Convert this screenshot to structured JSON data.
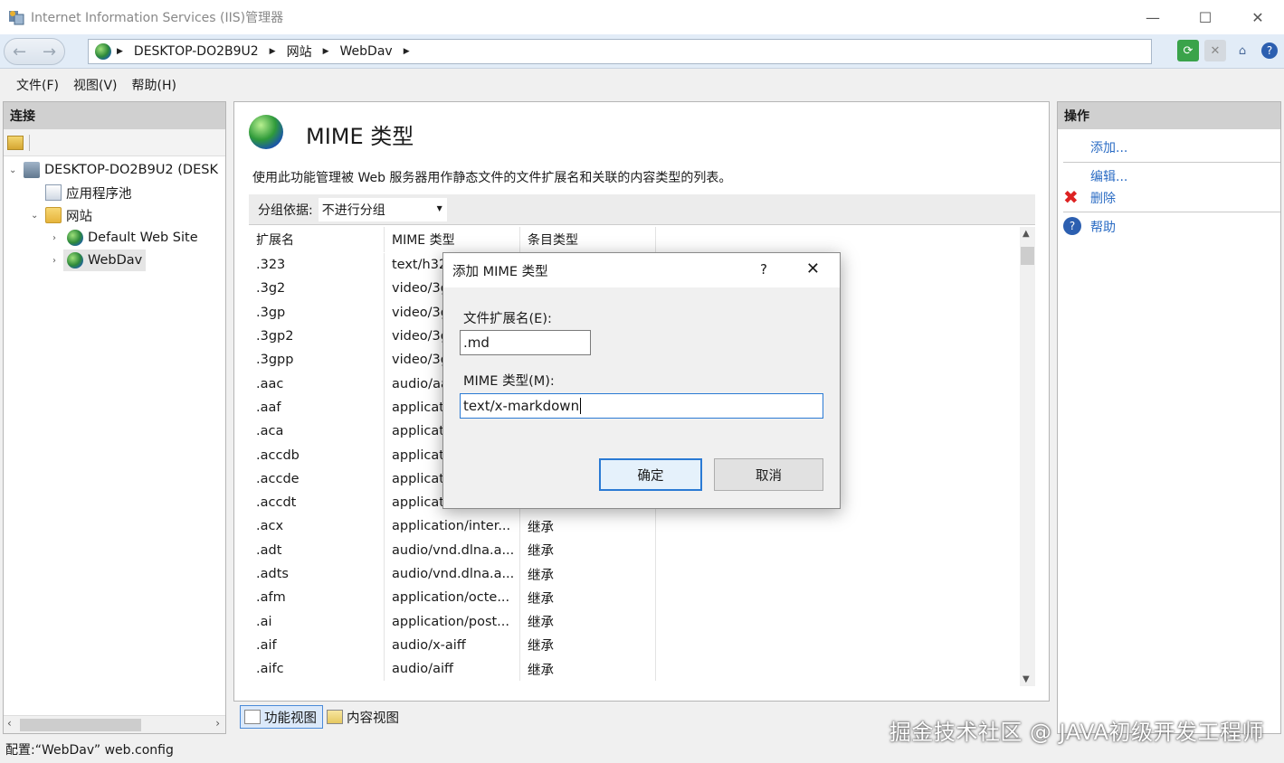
{
  "window": {
    "title": "Internet Information Services (IIS)管理器",
    "minimize": "—",
    "maximize": "☐",
    "close": "✕"
  },
  "address": {
    "segments": [
      "DESKTOP-DO2B9U2",
      "网站",
      "WebDav"
    ]
  },
  "menu": [
    "文件(F)",
    "视图(V)",
    "帮助(H)"
  ],
  "connections": {
    "header": "连接",
    "tree": [
      {
        "label": "DESKTOP-DO2B9U2 (DESK",
        "icon": "server-icon"
      },
      {
        "label": "应用程序池",
        "icon": "app-pool-icon"
      },
      {
        "label": "网站",
        "icon": "folder-icon"
      },
      {
        "label": "Default Web Site",
        "icon": "globe-icon"
      },
      {
        "label": "WebDav",
        "icon": "globe-icon"
      }
    ]
  },
  "main": {
    "title": "MIME 类型",
    "description": "使用此功能管理被 Web 服务器用作静态文件的文件扩展名和关联的内容类型的列表。",
    "group_label": "分组依据:",
    "group_value": "不进行分组",
    "columns": [
      "扩展名",
      "MIME 类型",
      "条目类型"
    ],
    "rows": [
      [
        ".323",
        "text/h323",
        ""
      ],
      [
        ".3g2",
        "video/3gpp2",
        ""
      ],
      [
        ".3gp",
        "video/3gpp",
        ""
      ],
      [
        ".3gp2",
        "video/3gpp2",
        ""
      ],
      [
        ".3gpp",
        "video/3gpp",
        ""
      ],
      [
        ".aac",
        "audio/aac",
        ""
      ],
      [
        ".aaf",
        "application/octet-stream",
        ""
      ],
      [
        ".aca",
        "application/octet-stream",
        ""
      ],
      [
        ".accdb",
        "application/msaccess",
        ""
      ],
      [
        ".accde",
        "application/msaccess",
        ""
      ],
      [
        ".accdt",
        "application/msaccess",
        ""
      ],
      [
        ".acx",
        "application/inter...",
        "继承"
      ],
      [
        ".adt",
        "audio/vnd.dlna.a...",
        "继承"
      ],
      [
        ".adts",
        "audio/vnd.dlna.a...",
        "继承"
      ],
      [
        ".afm",
        "application/octe...",
        "继承"
      ],
      [
        ".ai",
        "application/post...",
        "继承"
      ],
      [
        ".aif",
        "audio/x-aiff",
        "继承"
      ],
      [
        ".aifc",
        "audio/aiff",
        "继承"
      ]
    ],
    "view_tabs": [
      "功能视图",
      "内容视图"
    ]
  },
  "actions": {
    "header": "操作",
    "add": "添加...",
    "edit": "编辑...",
    "delete": "删除",
    "help": "帮助"
  },
  "dialog": {
    "title": "添加 MIME 类型",
    "help_glyph": "?",
    "close_glyph": "✕",
    "ext_label": "文件扩展名(E):",
    "ext_value": ".md",
    "mime_label": "MIME 类型(M):",
    "mime_value": "text/x-markdown",
    "ok": "确定",
    "cancel": "取消"
  },
  "status": "配置:“WebDav” web.config",
  "watermark": "掘金技术社区 @ JAVA初级开发工程师"
}
